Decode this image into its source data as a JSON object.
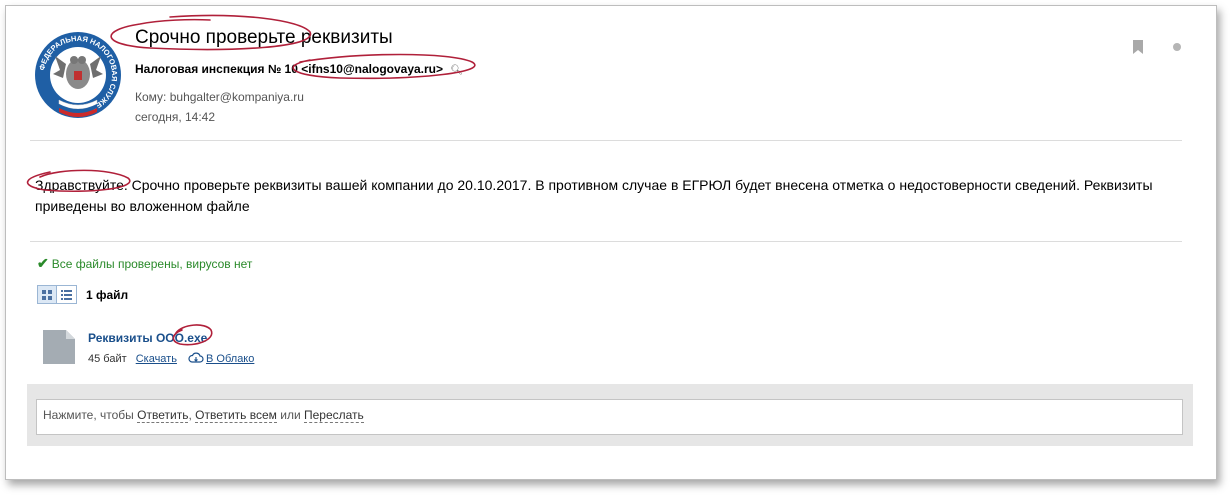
{
  "email": {
    "subject": "Срочно проверьте реквизиты",
    "sender_name": "Налоговая инспекция № 10",
    "sender_email": "<ifns10@nalogovaya.ru>",
    "recipient": "Кому: buhgalter@kompaniya.ru",
    "date": "сегодня, 14:42",
    "body": "Здравствуйте. Срочно проверьте реквизиты вашей компании до 20.10.2017. В противном случае в ЕГРЮЛ будет внесена отметка о недостоверности сведений. Реквизиты приведены во вложенном файле"
  },
  "logo": {
    "ring_text": "ФЕДЕРАЛЬНАЯ НАЛОГОВАЯ СЛУЖБА",
    "ring_color": "#1f5fa5",
    "flag_colors": [
      "#ffffff",
      "#1f5fa5",
      "#cc2a2a"
    ]
  },
  "attachments": {
    "scan_status": "Все файлы проверены, вирусов нет",
    "count_label": "1 файл",
    "files": [
      {
        "name": "Реквизиты ООО.exe",
        "size": "45 байт",
        "download_label": "Скачать",
        "cloud_label": "В Облако"
      }
    ]
  },
  "reply": {
    "prefix": "Нажмите, чтобы ",
    "reply_label": "Ответить",
    "sep1": ", ",
    "reply_all_label": "Ответить всем",
    "sep2": " или ",
    "forward_label": "Переслать"
  },
  "icons": {
    "bookmark": "bookmark-icon",
    "more": "dot-icon",
    "search": "search-icon",
    "check": "check-icon",
    "grid_view": "grid-view-icon",
    "list_view": "list-view-icon",
    "file": "file-icon",
    "cloud": "cloud-upload-icon"
  },
  "colors": {
    "link": "#1a4f8b",
    "success": "#2a8a2a",
    "annotation": "#b0203a"
  }
}
